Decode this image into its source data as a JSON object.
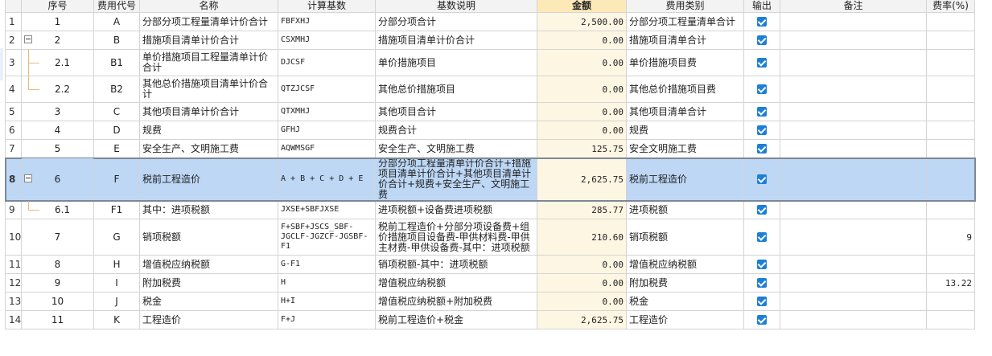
{
  "headers": {
    "seq": "序号",
    "code": "费用代号",
    "name": "名称",
    "base": "计算基数",
    "desc": "基数说明",
    "amount": "金额",
    "category": "费用类别",
    "output": "输出",
    "note": "备注",
    "rate": "费率(%)"
  },
  "rows": [
    {
      "row": "1",
      "seq": "1",
      "code": "A",
      "name": "分部分项工程量清单计价合计",
      "base": "FBFXHJ",
      "desc": "分部分项合计",
      "amount": "2,500.00",
      "category": "分部分项工程量清单合计",
      "output": true,
      "note": "",
      "rate": ""
    },
    {
      "row": "2",
      "seq": "2",
      "code": "B",
      "name": "措施项目清单计价合计",
      "base": "CSXMHJ",
      "desc": "措施项目清单计价合计",
      "amount": "0.00",
      "category": "措施项目清单合计",
      "output": true,
      "note": "",
      "rate": ""
    },
    {
      "row": "3",
      "seq": "2.1",
      "code": "B1",
      "name": "单价措施项目工程量清单计价合计",
      "base": "DJCSF",
      "desc": "单价措施项目",
      "amount": "0.00",
      "category": "单价措施项目费",
      "output": true,
      "note": "",
      "rate": ""
    },
    {
      "row": "4",
      "seq": "2.2",
      "code": "B2",
      "name": "其他总价措施项目清单计价合计",
      "base": "QTZJCSF",
      "desc": "其他总价措施项目",
      "amount": "0.00",
      "category": "其他总价措施项目费",
      "output": true,
      "note": "",
      "rate": ""
    },
    {
      "row": "5",
      "seq": "3",
      "code": "C",
      "name": "其他项目清单计价合计",
      "base": "QTXMHJ",
      "desc": "其他项目合计",
      "amount": "0.00",
      "category": "其他项目清单合计",
      "output": true,
      "note": "",
      "rate": ""
    },
    {
      "row": "6",
      "seq": "4",
      "code": "D",
      "name": "规费",
      "base": "GFHJ",
      "desc": "规费合计",
      "amount": "0.00",
      "category": "规费",
      "output": true,
      "note": "",
      "rate": ""
    },
    {
      "row": "7",
      "seq": "5",
      "code": "E",
      "name": "安全生产、文明施工费",
      "base": "AQWMSGF",
      "desc": "安全生产、文明施工费",
      "amount": "125.75",
      "category": "安全文明施工费",
      "output": true,
      "note": "",
      "rate": ""
    },
    {
      "row": "8",
      "seq": "6",
      "code": "F",
      "name": "税前工程造价",
      "base": "A + B + C + D + E",
      "desc": "分部分项工程量清单计价合计+措施项目清单计价合计+其他项目清单计价合计+规费+安全生产、文明施工费",
      "amount": "2,625.75",
      "category": "税前工程造价",
      "output": true,
      "note": "",
      "rate": ""
    },
    {
      "row": "9",
      "seq": "6.1",
      "code": "F1",
      "name": "其中：进项税额",
      "base": "JXSE+SBFJXSE",
      "desc": "进项税额+设备费进项税额",
      "amount": "285.77",
      "category": "进项税额",
      "output": true,
      "note": "",
      "rate": ""
    },
    {
      "row": "10",
      "seq": "7",
      "code": "G",
      "name": "销项税额",
      "base": "F+SBF+JSCS_SBF-JGCLF-JGZCF-JGSBF-F1",
      "desc": "税前工程造价+分部分项设备费+组价措施项目设备费-甲供材料费-甲供主材费-甲供设备费-其中：进项税额",
      "amount": "210.60",
      "category": "销项税额",
      "output": true,
      "note": "",
      "rate": "9"
    },
    {
      "row": "11",
      "seq": "8",
      "code": "H",
      "name": "增值税应纳税额",
      "base": "G-F1",
      "desc": "销项税额-其中：进项税额",
      "amount": "0.00",
      "category": "增值税应纳税额",
      "output": true,
      "note": "",
      "rate": ""
    },
    {
      "row": "12",
      "seq": "9",
      "code": "I",
      "name": "附加税费",
      "base": "H",
      "desc": "增值税应纳税额",
      "amount": "0.00",
      "category": "附加税费",
      "output": true,
      "note": "",
      "rate": "13.22"
    },
    {
      "row": "13",
      "seq": "10",
      "code": "J",
      "name": "税金",
      "base": "H+I",
      "desc": "增值税应纳税额+附加税费",
      "amount": "0.00",
      "category": "税金",
      "output": true,
      "note": "",
      "rate": ""
    },
    {
      "row": "14",
      "seq": "11",
      "code": "K",
      "name": "工程造价",
      "base": "F+J",
      "desc": "税前工程造价+税金",
      "amount": "2,625.75",
      "category": "工程造价",
      "output": true,
      "note": "",
      "rate": ""
    }
  ],
  "colors": {
    "accent": "#1d7fd6",
    "selected_row": "#bdd7f5",
    "amount_header": "#fde9b8"
  }
}
